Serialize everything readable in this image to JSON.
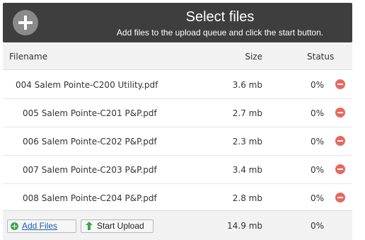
{
  "header": {
    "title": "Select files",
    "subtitle": "Add files to the upload queue and click the start button."
  },
  "columns": {
    "filename": "Filename",
    "size": "Size",
    "status": "Status"
  },
  "files": [
    {
      "name": "004 Salem Pointe-C200 Utility.pdf",
      "size": "3.6 mb",
      "status": "0%"
    },
    {
      "name": "005 Salem Pointe-C201 P&P.pdf",
      "size": "2.7 mb",
      "status": "0%"
    },
    {
      "name": "006 Salem Pointe-C202 P&P.pdf",
      "size": "2.3 mb",
      "status": "0%"
    },
    {
      "name": "007 Salem Pointe-C203 P&P.pdf",
      "size": "3.4 mb",
      "status": "0%"
    },
    {
      "name": "008 Salem Pointe-C204 P&P.pdf",
      "size": "2.8 mb",
      "status": "0%"
    }
  ],
  "footer": {
    "add_files_label": "Add Files",
    "start_upload_label": "Start Upload",
    "total_size": "14.9 mb",
    "total_status": "0%"
  },
  "icons": {
    "add": "plus-circle-icon",
    "remove": "minus-circle-icon",
    "add_files": "green-plus-icon",
    "start_upload": "green-up-arrow-icon"
  },
  "colors": {
    "header_bg": "#3e3e3e",
    "remove_red": "#e8675e",
    "add_green": "#3aa84a",
    "link_blue": "#1a5fb4"
  }
}
